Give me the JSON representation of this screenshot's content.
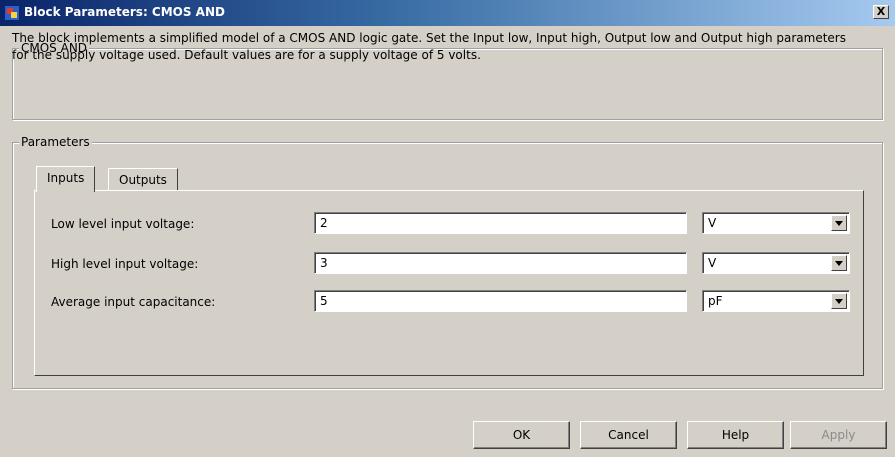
{
  "window": {
    "title": "Block Parameters: CMOS AND",
    "close_label": "X"
  },
  "block": {
    "group_title": "CMOS AND",
    "description": "The block implements a simplified model of a CMOS AND logic gate. Set the Input low, Input high, Output low and Output high parameters for the supply voltage used. Default values are for a supply voltage of 5 volts."
  },
  "parameters": {
    "group_title": "Parameters",
    "tabs": [
      {
        "label": "Inputs",
        "active": true
      },
      {
        "label": "Outputs",
        "active": false
      }
    ],
    "rows": [
      {
        "label": "Low level input voltage:",
        "value": "2",
        "unit": "V"
      },
      {
        "label": "High level input voltage:",
        "value": "3",
        "unit": "V"
      },
      {
        "label": "Average input capacitance:",
        "value": "5",
        "unit": "pF"
      }
    ]
  },
  "buttons": {
    "ok": "OK",
    "cancel": "Cancel",
    "help": "Help",
    "apply": "Apply"
  },
  "colors": {
    "titlebar_start": "#0a246a",
    "titlebar_end": "#a6caf0",
    "dialog_face": "#d4d0c8"
  }
}
